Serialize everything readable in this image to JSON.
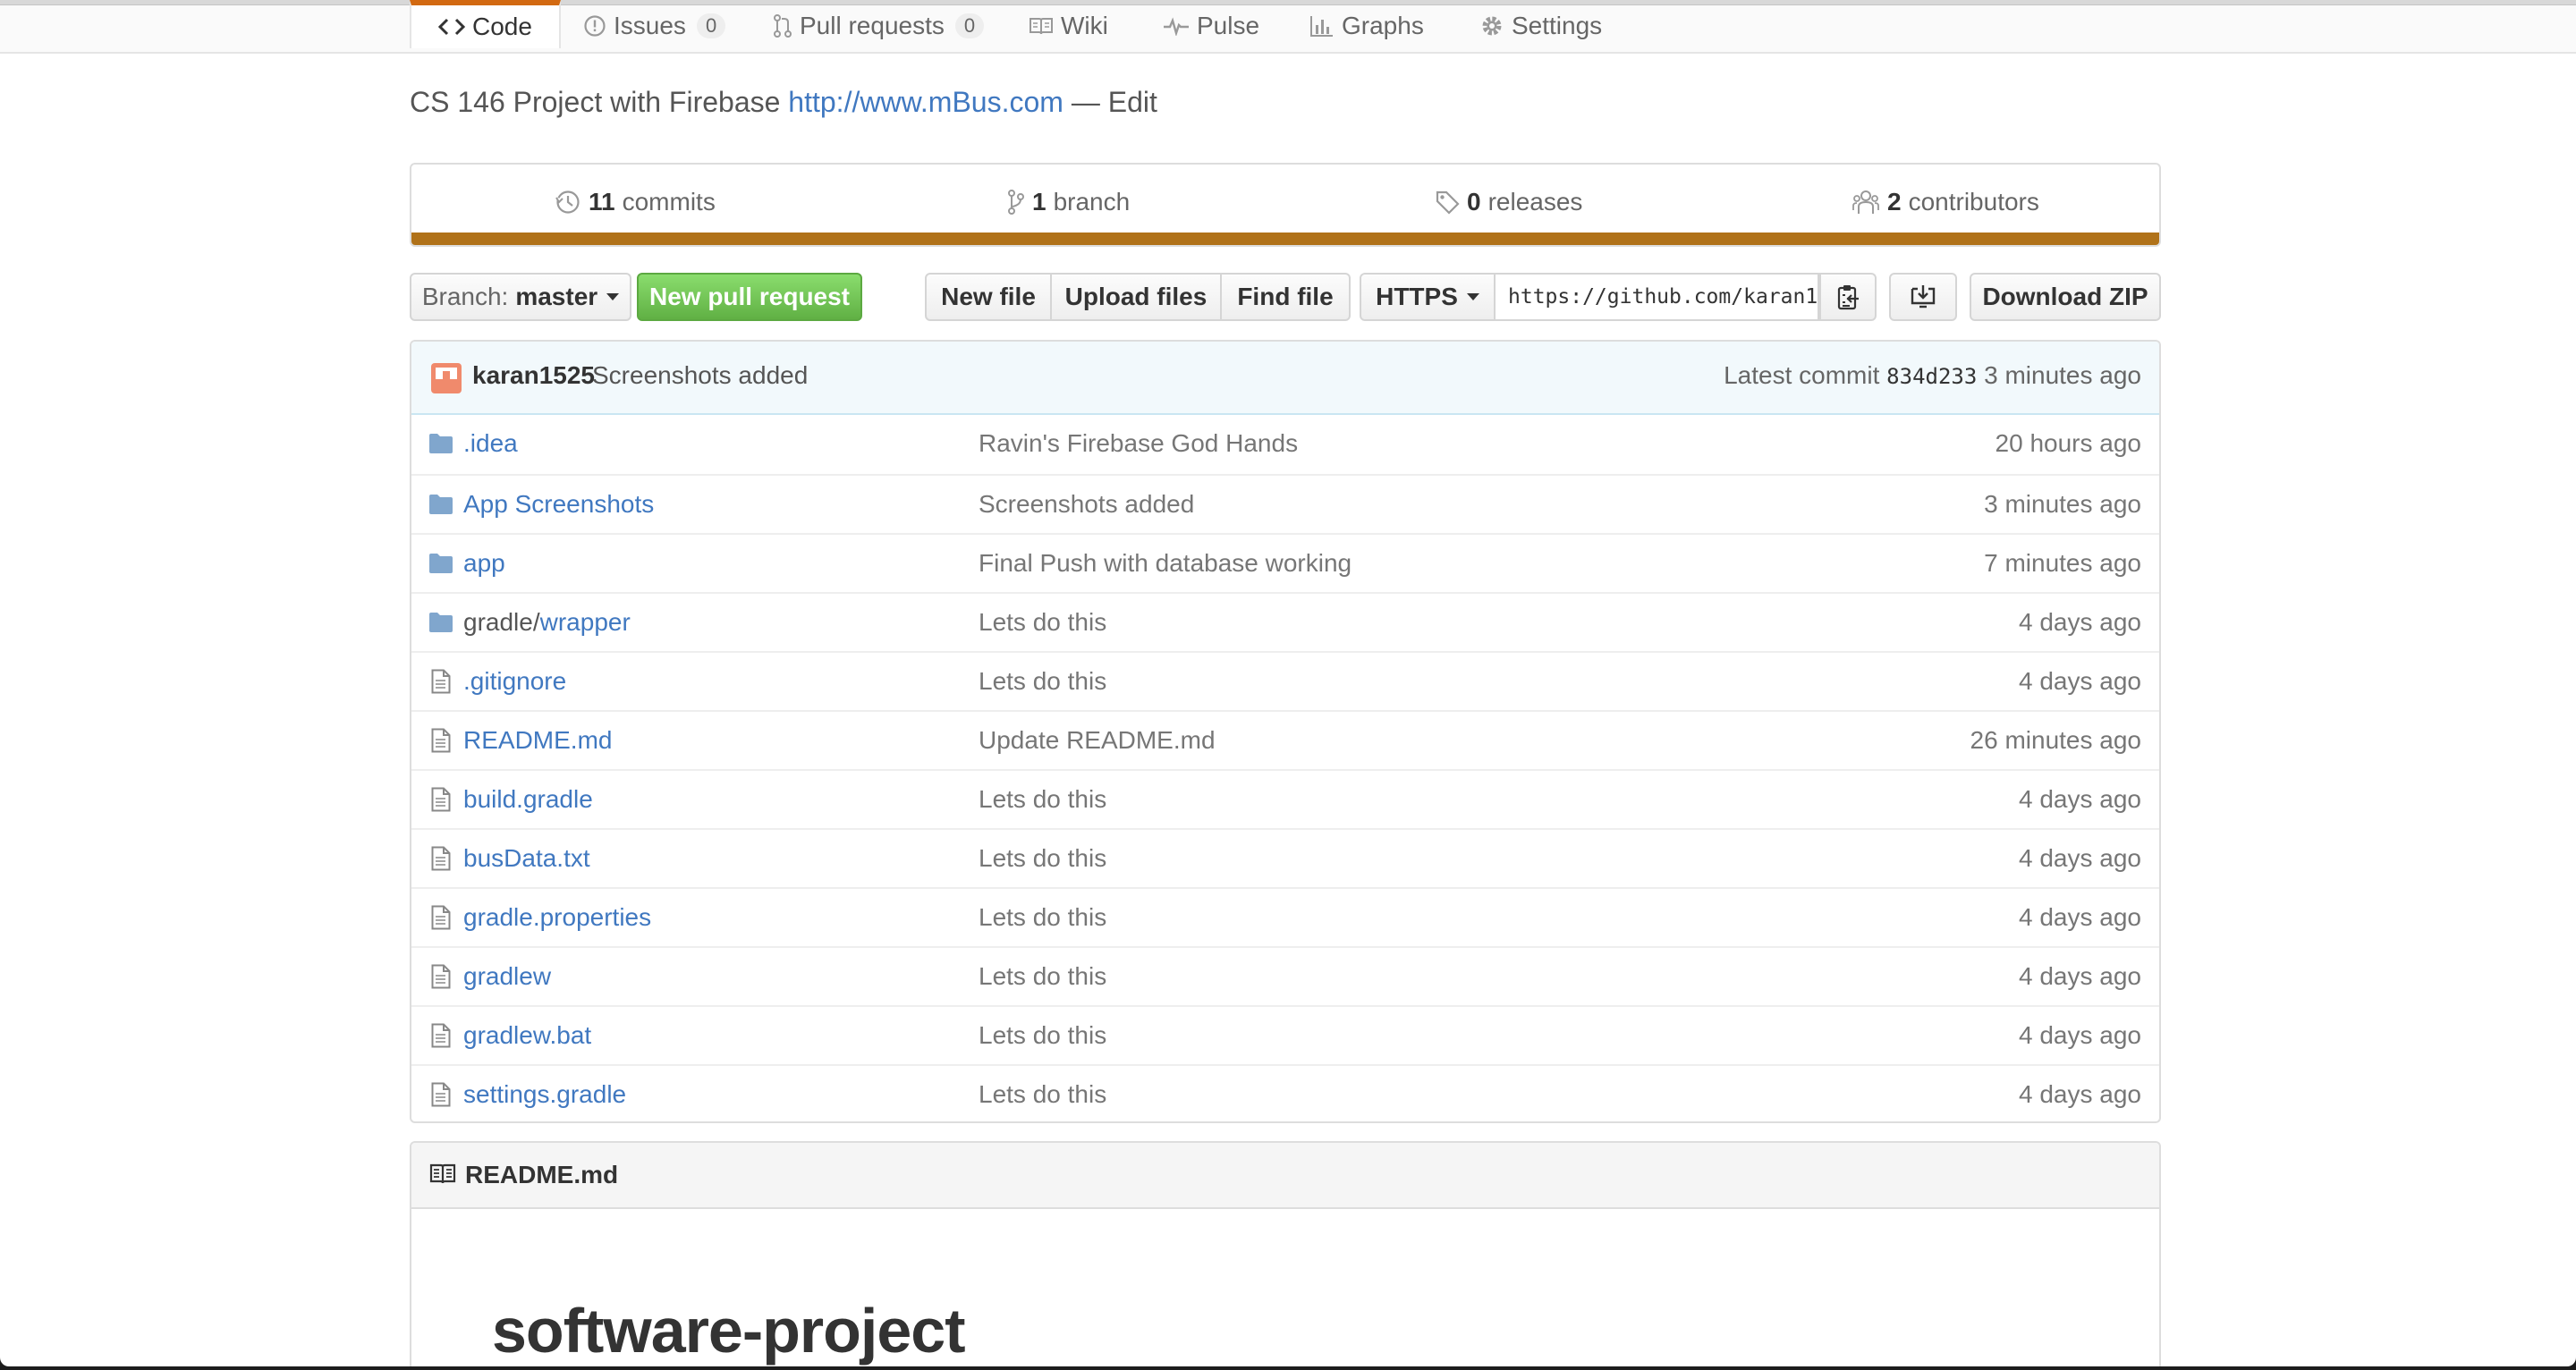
{
  "tabs": [
    {
      "label": "Code",
      "icon": "code-icon",
      "selected": true
    },
    {
      "label": "Issues",
      "icon": "issue-icon",
      "count": "0"
    },
    {
      "label": "Pull requests",
      "icon": "pull-request-icon",
      "count": "0"
    },
    {
      "label": "Wiki",
      "icon": "book-icon"
    },
    {
      "label": "Pulse",
      "icon": "pulse-icon"
    },
    {
      "label": "Graphs",
      "icon": "graph-icon"
    },
    {
      "label": "Settings",
      "icon": "gear-icon"
    }
  ],
  "description": {
    "text": "CS 146 Project with Firebase",
    "website": "http://www.mBus.com",
    "edit": "— Edit"
  },
  "summary": {
    "commits": {
      "count": "11",
      "label": "commits"
    },
    "branch": {
      "count": "1",
      "label": "branch"
    },
    "releases": {
      "count": "0",
      "label": "releases"
    },
    "contributors": {
      "count": "2",
      "label": "contributors"
    },
    "language_color": "#b07219"
  },
  "toolbar": {
    "branch_label": "Branch:",
    "branch_name": "master",
    "new_pull_request": "New pull request",
    "new_file": "New file",
    "upload_files": "Upload files",
    "find_file": "Find file",
    "protocol": "HTTPS",
    "clone_url": "https://github.com/karan1",
    "download_zip": "Download ZIP"
  },
  "latest_commit": {
    "author": "karan1525",
    "message": "Screenshots added",
    "label": "Latest commit",
    "sha": "834d233",
    "age": "3 minutes ago"
  },
  "files": [
    {
      "type": "dir",
      "name": ".idea",
      "message": "Ravin's Firebase God Hands",
      "age": "20 hours ago"
    },
    {
      "type": "dir",
      "name": "App Screenshots",
      "message": "Screenshots added",
      "age": "3 minutes ago"
    },
    {
      "type": "dir",
      "name": "app",
      "message": "Final Push with database working",
      "age": "7 minutes ago"
    },
    {
      "type": "dir",
      "prefix": "gradle/",
      "name": "wrapper",
      "message": "Lets do this",
      "age": "4 days ago"
    },
    {
      "type": "file",
      "name": ".gitignore",
      "message": "Lets do this",
      "age": "4 days ago"
    },
    {
      "type": "file",
      "name": "README.md",
      "message": "Update README.md",
      "age": "26 minutes ago"
    },
    {
      "type": "file",
      "name": "build.gradle",
      "message": "Lets do this",
      "age": "4 days ago"
    },
    {
      "type": "file",
      "name": "busData.txt",
      "message": "Lets do this",
      "age": "4 days ago"
    },
    {
      "type": "file",
      "name": "gradle.properties",
      "message": "Lets do this",
      "age": "4 days ago"
    },
    {
      "type": "file",
      "name": "gradlew",
      "message": "Lets do this",
      "age": "4 days ago"
    },
    {
      "type": "file",
      "name": "gradlew.bat",
      "message": "Lets do this",
      "age": "4 days ago"
    },
    {
      "type": "file",
      "name": "settings.gradle",
      "message": "Lets do this",
      "age": "4 days ago"
    }
  ],
  "readme": {
    "filename": "README.md",
    "heading": "software-project"
  },
  "colors": {
    "link": "#4078c0",
    "primary_button": "#60b044",
    "selected_tab_accent": "#d26911",
    "commit_bar": "#f2f9fc",
    "folder": "#80a6cd"
  }
}
